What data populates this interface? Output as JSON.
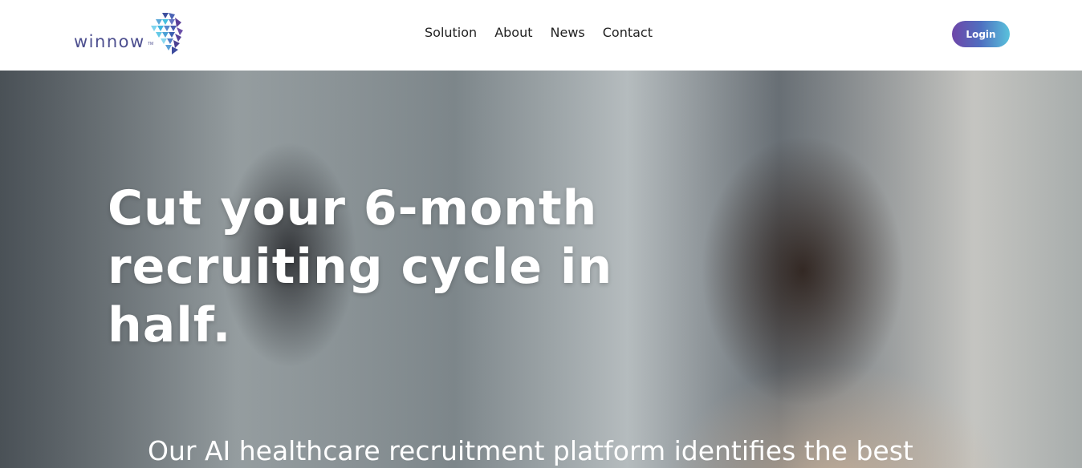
{
  "header": {
    "logo": {
      "text": "winnow",
      "tm": "TM",
      "icon": "winnow-face-icon"
    },
    "nav": [
      {
        "label": "Solution"
      },
      {
        "label": "About"
      },
      {
        "label": "News"
      },
      {
        "label": "Contact"
      }
    ],
    "login_label": "Login"
  },
  "hero": {
    "headline": "Cut your 6-month recruiting cycle in half.",
    "subtext": "Our AI healthcare recruitment platform identifies the best",
    "image": "smiling-woman-photo"
  },
  "colors": {
    "brand": "#4d4f8f",
    "login_gradient_start": "#6e46a8",
    "login_gradient_end": "#59c2dc"
  }
}
